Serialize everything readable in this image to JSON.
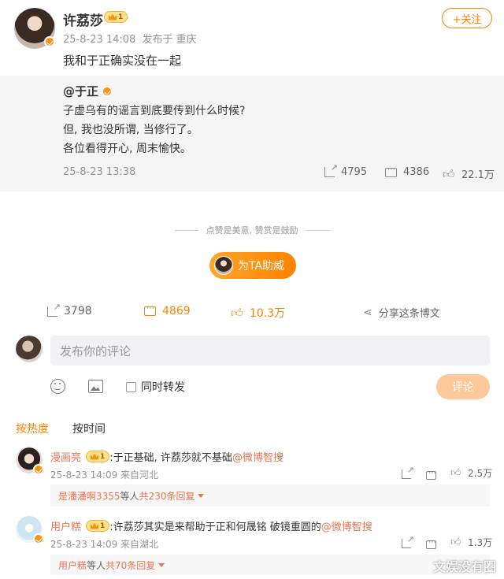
{
  "post": {
    "author": "许荔莎",
    "level": "1",
    "time": "25-8-23 14:08",
    "source": "发布于 重庆",
    "follow_label": "+关注",
    "text": "我和于正确实没在一起"
  },
  "retweet": {
    "author": "@于正",
    "lines": [
      "子虚乌有的谣言到底要传到什么时候?",
      "但, 我也没所谓, 当修行了。",
      "各位看得开心, 周末愉快。"
    ],
    "time": "25-8-23 13:38",
    "reposts": "4795",
    "comments": "4386",
    "likes": "22.1万"
  },
  "reward": {
    "tagline": "点赞是美意, 赞赏是鼓励",
    "button_label": "为TA助威"
  },
  "actions": {
    "reposts": "3798",
    "comments": "4869",
    "likes": "10.3万",
    "share": "分享这条博文"
  },
  "composer": {
    "placeholder": "发布你的评论",
    "repost_label": "同时转发",
    "submit_label": "评论"
  },
  "sort": {
    "hot": "按热度",
    "time": "按时间"
  },
  "comments": [
    {
      "user": "漫画亮",
      "level": "1",
      "text": ":于正基础, 许荔莎就不基础",
      "mention": "@微博智搜",
      "time": "25-8-23 14:09 来自河北",
      "likes": "2.5万",
      "reply_user": "是潘潘啊3355",
      "reply_mid": " 等人 ",
      "reply_count": "共230条回复"
    },
    {
      "user": "用户糕",
      "level": "1",
      "text": ":许荔莎其实是来帮助于正和何晟铭 破镜重圆的",
      "mention": "@微博智搜",
      "time": "25-8-23 14:09 来自湖北",
      "likes": "1.3万",
      "reply_user": "用户糕",
      "reply_mid": " 等人 ",
      "reply_count": "共70条回复"
    }
  ],
  "watermark": "文娱没有圈",
  "colors": {
    "accent": "#ff8200",
    "link": "#eb7350",
    "bg_gray": "#f5f5f5"
  }
}
